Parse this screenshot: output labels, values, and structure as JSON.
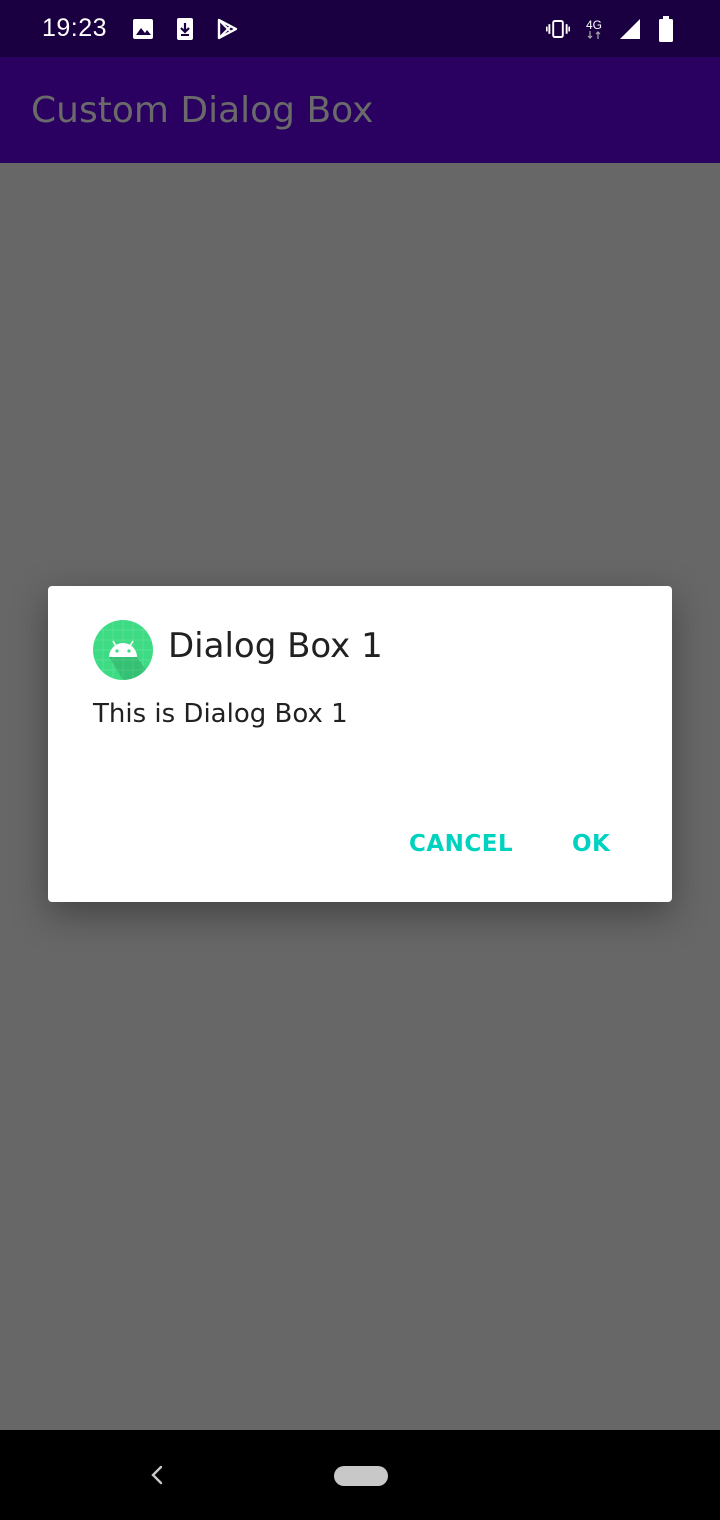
{
  "status_bar": {
    "time": "19:23",
    "left_icons": [
      "image-icon",
      "download-icon",
      "play-store-icon"
    ],
    "right_icons": [
      "vibrate-icon",
      "network-4g-icon",
      "signal-icon",
      "battery-icon"
    ],
    "network_label": "4G"
  },
  "app_bar": {
    "title": "Custom Dialog Box"
  },
  "dialog": {
    "icon": "android-icon",
    "title": "Dialog Box 1",
    "message": "This is Dialog Box 1",
    "cancel_label": "CANCEL",
    "ok_label": "OK",
    "accent_color": "#00d2c0"
  },
  "nav_bar": {
    "icons": [
      "back-icon",
      "home-pill"
    ]
  },
  "colors": {
    "status_bar": "#1a0040",
    "app_bar": "#2a0060",
    "scrim": "#676767"
  }
}
